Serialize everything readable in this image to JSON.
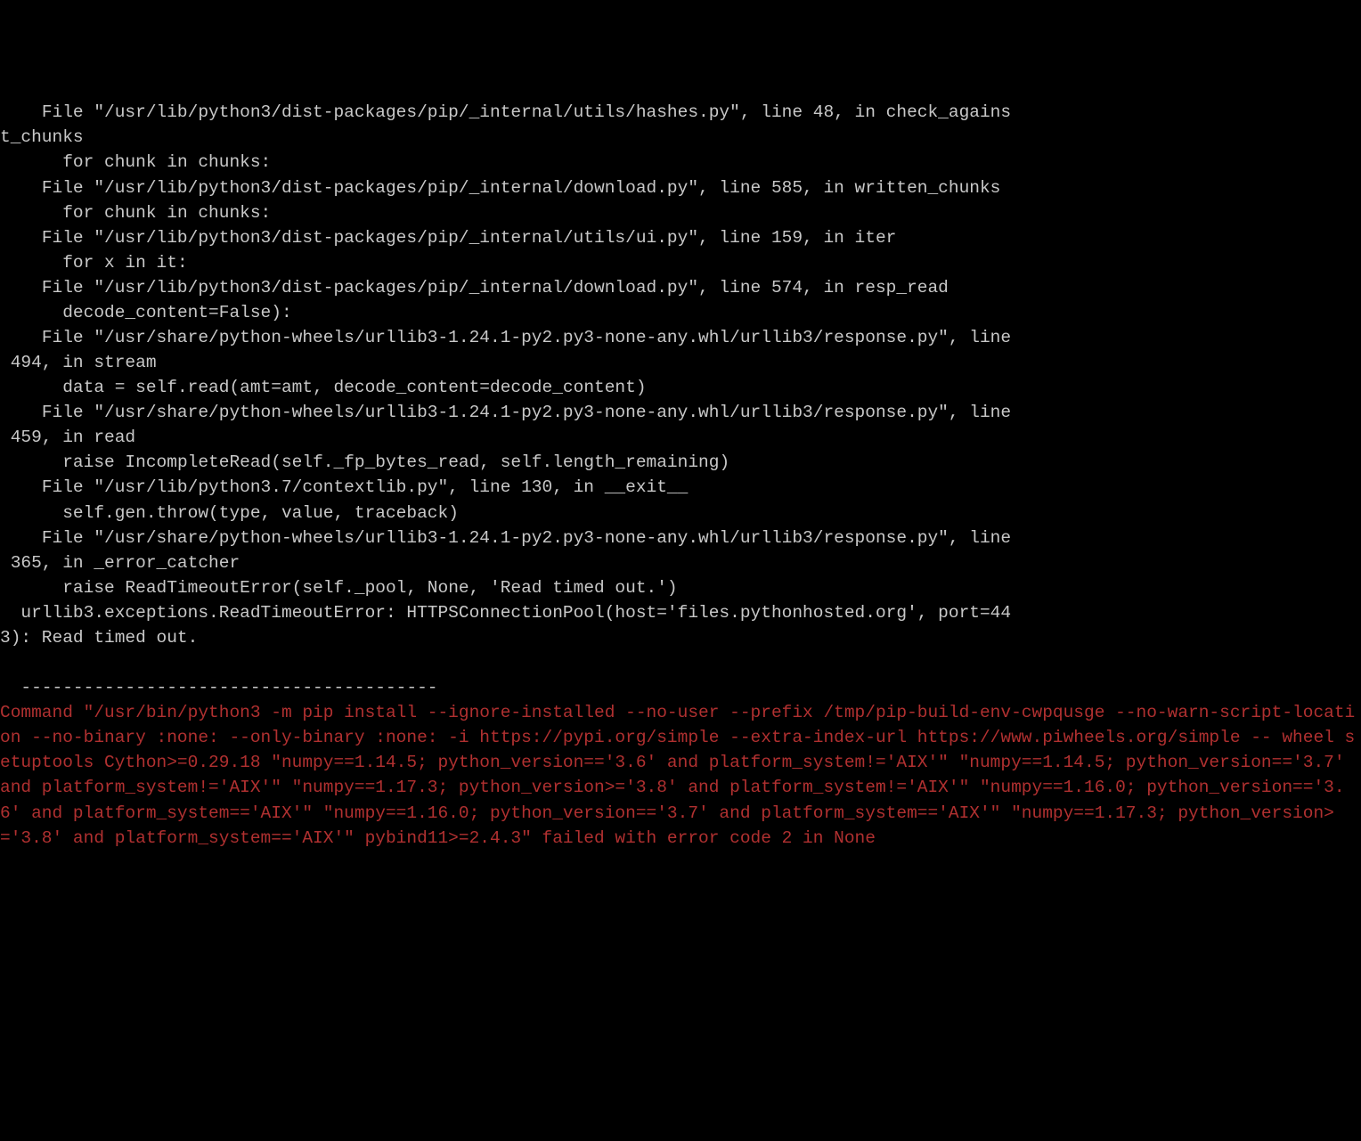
{
  "traceback": {
    "lines": [
      "    File \"/usr/lib/python3/dist-packages/pip/_internal/utils/hashes.py\", line 48, in check_agains",
      "t_chunks",
      "      for chunk in chunks:",
      "    File \"/usr/lib/python3/dist-packages/pip/_internal/download.py\", line 585, in written_chunks",
      "      for chunk in chunks:",
      "    File \"/usr/lib/python3/dist-packages/pip/_internal/utils/ui.py\", line 159, in iter",
      "      for x in it:",
      "    File \"/usr/lib/python3/dist-packages/pip/_internal/download.py\", line 574, in resp_read",
      "      decode_content=False):",
      "    File \"/usr/share/python-wheels/urllib3-1.24.1-py2.py3-none-any.whl/urllib3/response.py\", line",
      " 494, in stream",
      "      data = self.read(amt=amt, decode_content=decode_content)",
      "    File \"/usr/share/python-wheels/urllib3-1.24.1-py2.py3-none-any.whl/urllib3/response.py\", line",
      " 459, in read",
      "      raise IncompleteRead(self._fp_bytes_read, self.length_remaining)",
      "    File \"/usr/lib/python3.7/contextlib.py\", line 130, in __exit__",
      "      self.gen.throw(type, value, traceback)",
      "    File \"/usr/share/python-wheels/urllib3-1.24.1-py2.py3-none-any.whl/urllib3/response.py\", line",
      " 365, in _error_catcher",
      "      raise ReadTimeoutError(self._pool, None, 'Read timed out.')",
      "  urllib3.exceptions.ReadTimeoutError: HTTPSConnectionPool(host='files.pythonhosted.org', port=44",
      "3): Read timed out.",
      "  ",
      "  ----------------------------------------"
    ]
  },
  "error": {
    "text": "Command \"/usr/bin/python3 -m pip install --ignore-installed --no-user --prefix /tmp/pip-build-env-cwpqusge --no-warn-script-location --no-binary :none: --only-binary :none: -i https://pypi.org/simple --extra-index-url https://www.piwheels.org/simple -- wheel setuptools Cython>=0.29.18 \"numpy==1.14.5; python_version=='3.6' and platform_system!='AIX'\" \"numpy==1.14.5; python_version=='3.7' and platform_system!='AIX'\" \"numpy==1.17.3; python_version>='3.8' and platform_system!='AIX'\" \"numpy==1.16.0; python_version=='3.6' and platform_system=='AIX'\" \"numpy==1.16.0; python_version=='3.7' and platform_system=='AIX'\" \"numpy==1.17.3; python_version>='3.8' and platform_system=='AIX'\" pybind11>=2.4.3\" failed with error code 2 in None"
  }
}
